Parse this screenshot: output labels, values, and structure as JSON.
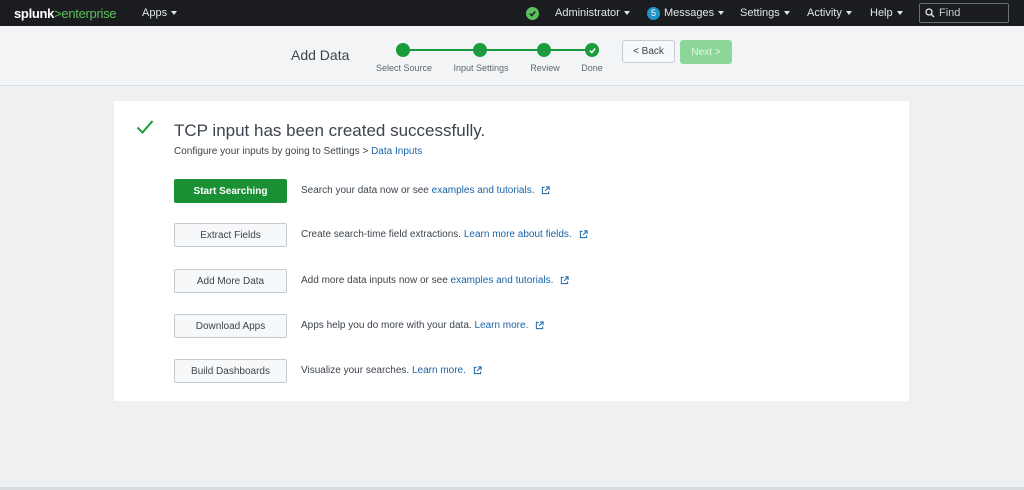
{
  "topbar": {
    "logo_main": "splunk",
    "logo_gt": ">",
    "logo_product": "enterprise",
    "apps_label": "Apps",
    "admin_label": "Administrator",
    "messages_count": "5",
    "messages_label": "Messages",
    "settings_label": "Settings",
    "activity_label": "Activity",
    "help_label": "Help",
    "find_placeholder": "Find"
  },
  "wizard": {
    "title": "Add Data",
    "steps": [
      {
        "label": "Select Source"
      },
      {
        "label": "Input Settings"
      },
      {
        "label": "Review"
      },
      {
        "label": "Done"
      }
    ],
    "back_label": "< Back",
    "next_label": "Next >"
  },
  "result": {
    "headline": "TCP input has been created successfully.",
    "sub_text": "Configure your inputs by going to Settings > ",
    "sub_link": "Data Inputs"
  },
  "actions": [
    {
      "button": "Start Searching",
      "text": "Search your data now or see ",
      "link": "examples and tutorials."
    },
    {
      "button": "Extract Fields",
      "text": "Create search-time field extractions. ",
      "link": "Learn more about fields."
    },
    {
      "button": "Add More Data",
      "text": "Add more data inputs now or see ",
      "link": "examples and tutorials."
    },
    {
      "button": "Download Apps",
      "text": "Apps help you do more with your data. ",
      "link": "Learn more."
    },
    {
      "button": "Build Dashboards",
      "text": "Visualize your searches. ",
      "link": "Learn more."
    }
  ],
  "colors": {
    "accent_green": "#1a9035",
    "link_blue": "#1a64a6",
    "topbar_bg": "#1a1c20"
  }
}
